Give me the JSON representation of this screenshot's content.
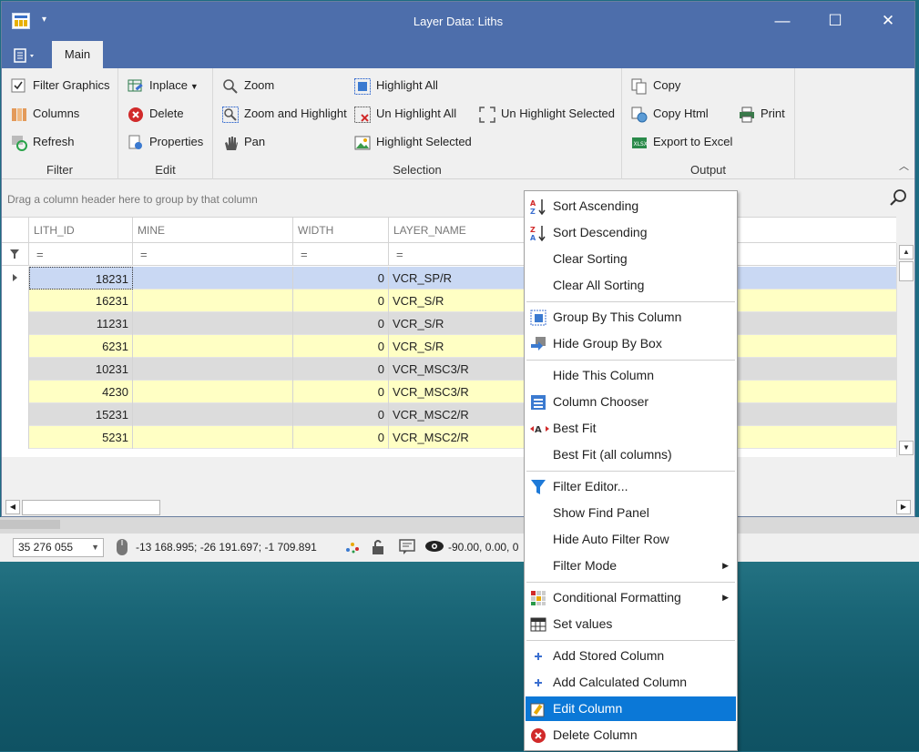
{
  "window": {
    "title": "Layer Data: Liths",
    "qa_dropdown": "▾",
    "btn_minimize": "—",
    "btn_maximize": "☐",
    "btn_close": "✕"
  },
  "ribbon": {
    "tab_main": "Main",
    "filter": {
      "label": "Filter",
      "items": [
        "Filter Graphics",
        "Columns",
        "Refresh"
      ]
    },
    "edit": {
      "label": "Edit",
      "items": [
        "Inplace",
        "Delete",
        "Properties"
      ]
    },
    "selection": {
      "label": "Selection",
      "items": [
        "Zoom",
        "Zoom and Highlight",
        "Pan",
        "Highlight All",
        "Un Highlight All",
        "Highlight Selected",
        "Un Highlight Selected"
      ]
    },
    "output": {
      "label": "Output",
      "items": [
        "Copy",
        "Copy Html",
        "Export to Excel",
        "Print"
      ]
    }
  },
  "grid": {
    "group_hint": "Drag a column header here to group by that column",
    "columns": [
      "LITH_ID",
      "MINE",
      "WIDTH",
      "LAYER_NAME"
    ],
    "filter_symbol": "=",
    "rows": [
      {
        "lith_id": "18231",
        "mine": "",
        "width": "0",
        "layer_name": "VCR_SP/R",
        "bg": "#c9d8f3"
      },
      {
        "lith_id": "16231",
        "mine": "",
        "width": "0",
        "layer_name": "VCR_S/R",
        "bg": "#ffffc4"
      },
      {
        "lith_id": "11231",
        "mine": "",
        "width": "0",
        "layer_name": "VCR_S/R",
        "bg": "#dcdcdc"
      },
      {
        "lith_id": "6231",
        "mine": "",
        "width": "0",
        "layer_name": "VCR_S/R",
        "bg": "#ffffc4"
      },
      {
        "lith_id": "10231",
        "mine": "",
        "width": "0",
        "layer_name": "VCR_MSC3/R",
        "bg": "#dcdcdc"
      },
      {
        "lith_id": "4230",
        "mine": "",
        "width": "0",
        "layer_name": "VCR_MSC3/R",
        "bg": "#ffffc4"
      },
      {
        "lith_id": "15231",
        "mine": "",
        "width": "0",
        "layer_name": "VCR_MSC2/R",
        "bg": "#dcdcdc"
      },
      {
        "lith_id": "5231",
        "mine": "",
        "width": "0",
        "layer_name": "VCR_MSC2/R",
        "bg": "#ffffc4"
      }
    ]
  },
  "statusbar": {
    "scale": "35 276 055",
    "coords": "-13 168.995; -26 191.697; -1 709.891",
    "view": "-90.00, 0.00, 0"
  },
  "context_menu": {
    "items": [
      "Sort Ascending",
      "Sort Descending",
      "Clear Sorting",
      "Clear All Sorting",
      "Group By This Column",
      "Hide Group By Box",
      "Hide This Column",
      "Column Chooser",
      "Best Fit",
      "Best Fit (all columns)",
      "Filter Editor...",
      "Show Find Panel",
      "Hide Auto Filter Row",
      "Filter Mode",
      "Conditional Formatting",
      "Set values",
      "Add Stored Column",
      "Add Calculated Column",
      "Edit Column",
      "Delete Column"
    ],
    "active": "Edit Column",
    "icons": {
      "sort_asc": "AZ",
      "sort_desc": "ZA",
      "best_fit": "A"
    }
  }
}
